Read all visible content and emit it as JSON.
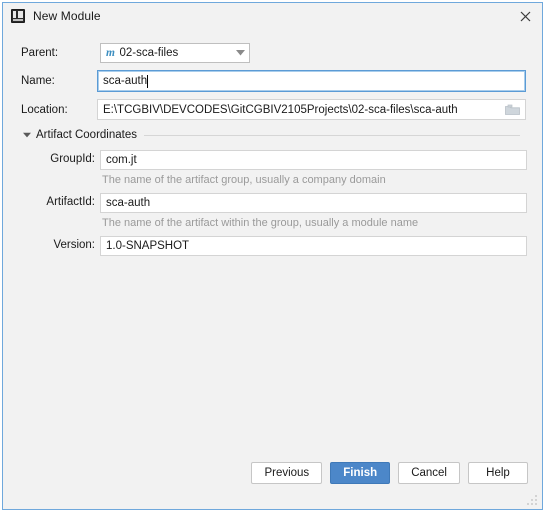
{
  "window": {
    "title": "New Module",
    "icon": "module-icon",
    "close_label": "×"
  },
  "form": {
    "parent": {
      "label": "Parent:",
      "icon_text": "m",
      "value": "02-sca-files"
    },
    "name": {
      "label": "Name:",
      "value": "sca-auth"
    },
    "location": {
      "label": "Location:",
      "value": "E:\\TCGBIV\\DEVCODES\\GitCGBIV2105Projects\\02-sca-files\\sca-auth"
    }
  },
  "artifact_section": {
    "title": "Artifact Coordinates",
    "expanded": true,
    "fields": [
      {
        "label": "GroupId:",
        "value": "com.jt",
        "hint": "The name of the artifact group, usually a company domain"
      },
      {
        "label": "ArtifactId:",
        "value": "sca-auth",
        "hint": "The name of the artifact within the group, usually a module name"
      },
      {
        "label": "Version:",
        "value": "1.0-SNAPSHOT",
        "hint": ""
      }
    ]
  },
  "footer": {
    "previous_label": "Previous",
    "finish_label": "Finish",
    "cancel_label": "Cancel",
    "help_label": "Help"
  },
  "colors": {
    "accent": "#4c87c9",
    "focus_border": "#5b9bd5",
    "window_border": "#6fa8dc",
    "maven_blue": "#3c8ec0",
    "background": "#f2f2f2",
    "hint_text": "#9a9a9a"
  }
}
